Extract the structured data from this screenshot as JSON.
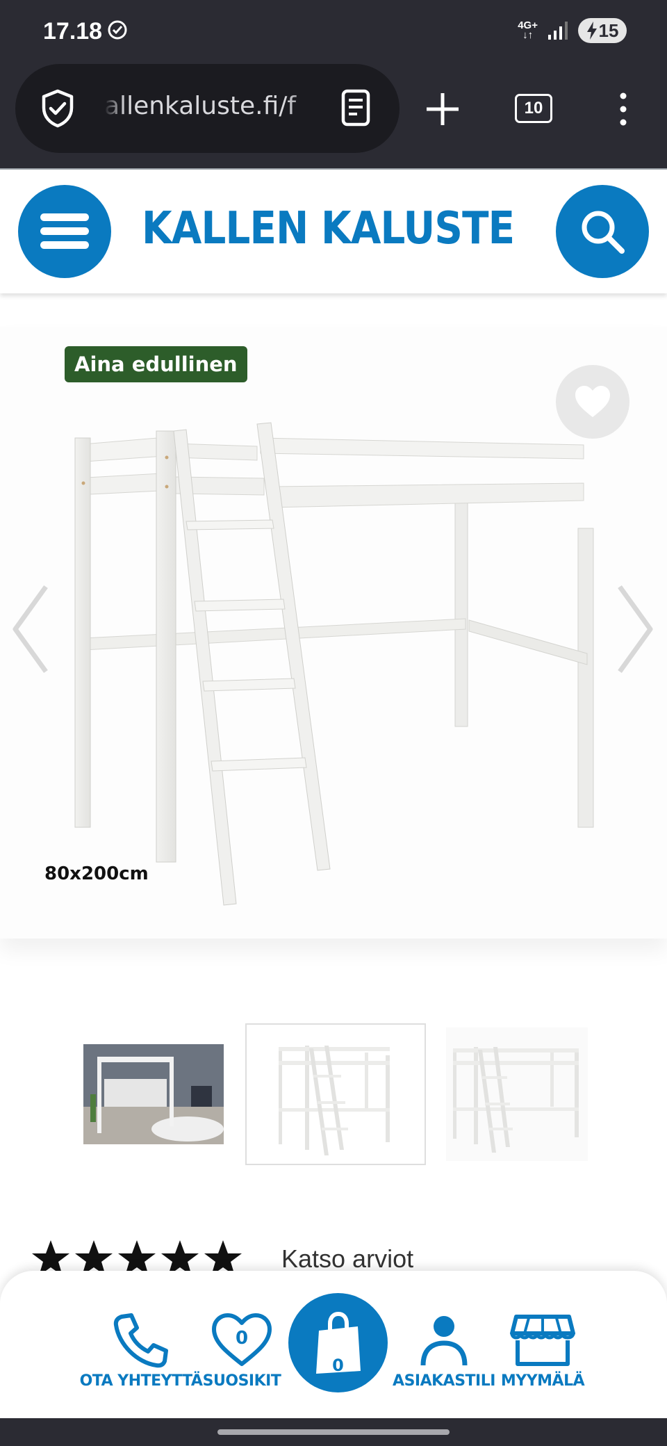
{
  "status_bar": {
    "time": "17.18",
    "network_top": "4G+",
    "network_bottom": "↓↑",
    "battery_level": "15"
  },
  "browser": {
    "url": "allenkaluste.fi/f",
    "open_tabs": "10"
  },
  "site": {
    "logo_text": "KALLEN KALUSTE",
    "brand_color": "#0a7ac0",
    "badge_color": "#2d5d2a"
  },
  "product": {
    "badge": "Aina edullinen",
    "size_label": "80x200cm",
    "rating_stars": 5,
    "rating_link": "Katso arviot",
    "thumbnails": [
      "room-photo",
      "loft-bed-angled",
      "loft-bed-front"
    ],
    "selected_thumbnail_index": 1
  },
  "bottom_nav": {
    "contact_label": "OTA YHTEYTTÄ",
    "favorites_label": "SUOSIKIT",
    "favorites_count": "0",
    "cart_count": "0",
    "account_label": "ASIAKASTILI",
    "store_label": "MYYMÄLÄ"
  }
}
